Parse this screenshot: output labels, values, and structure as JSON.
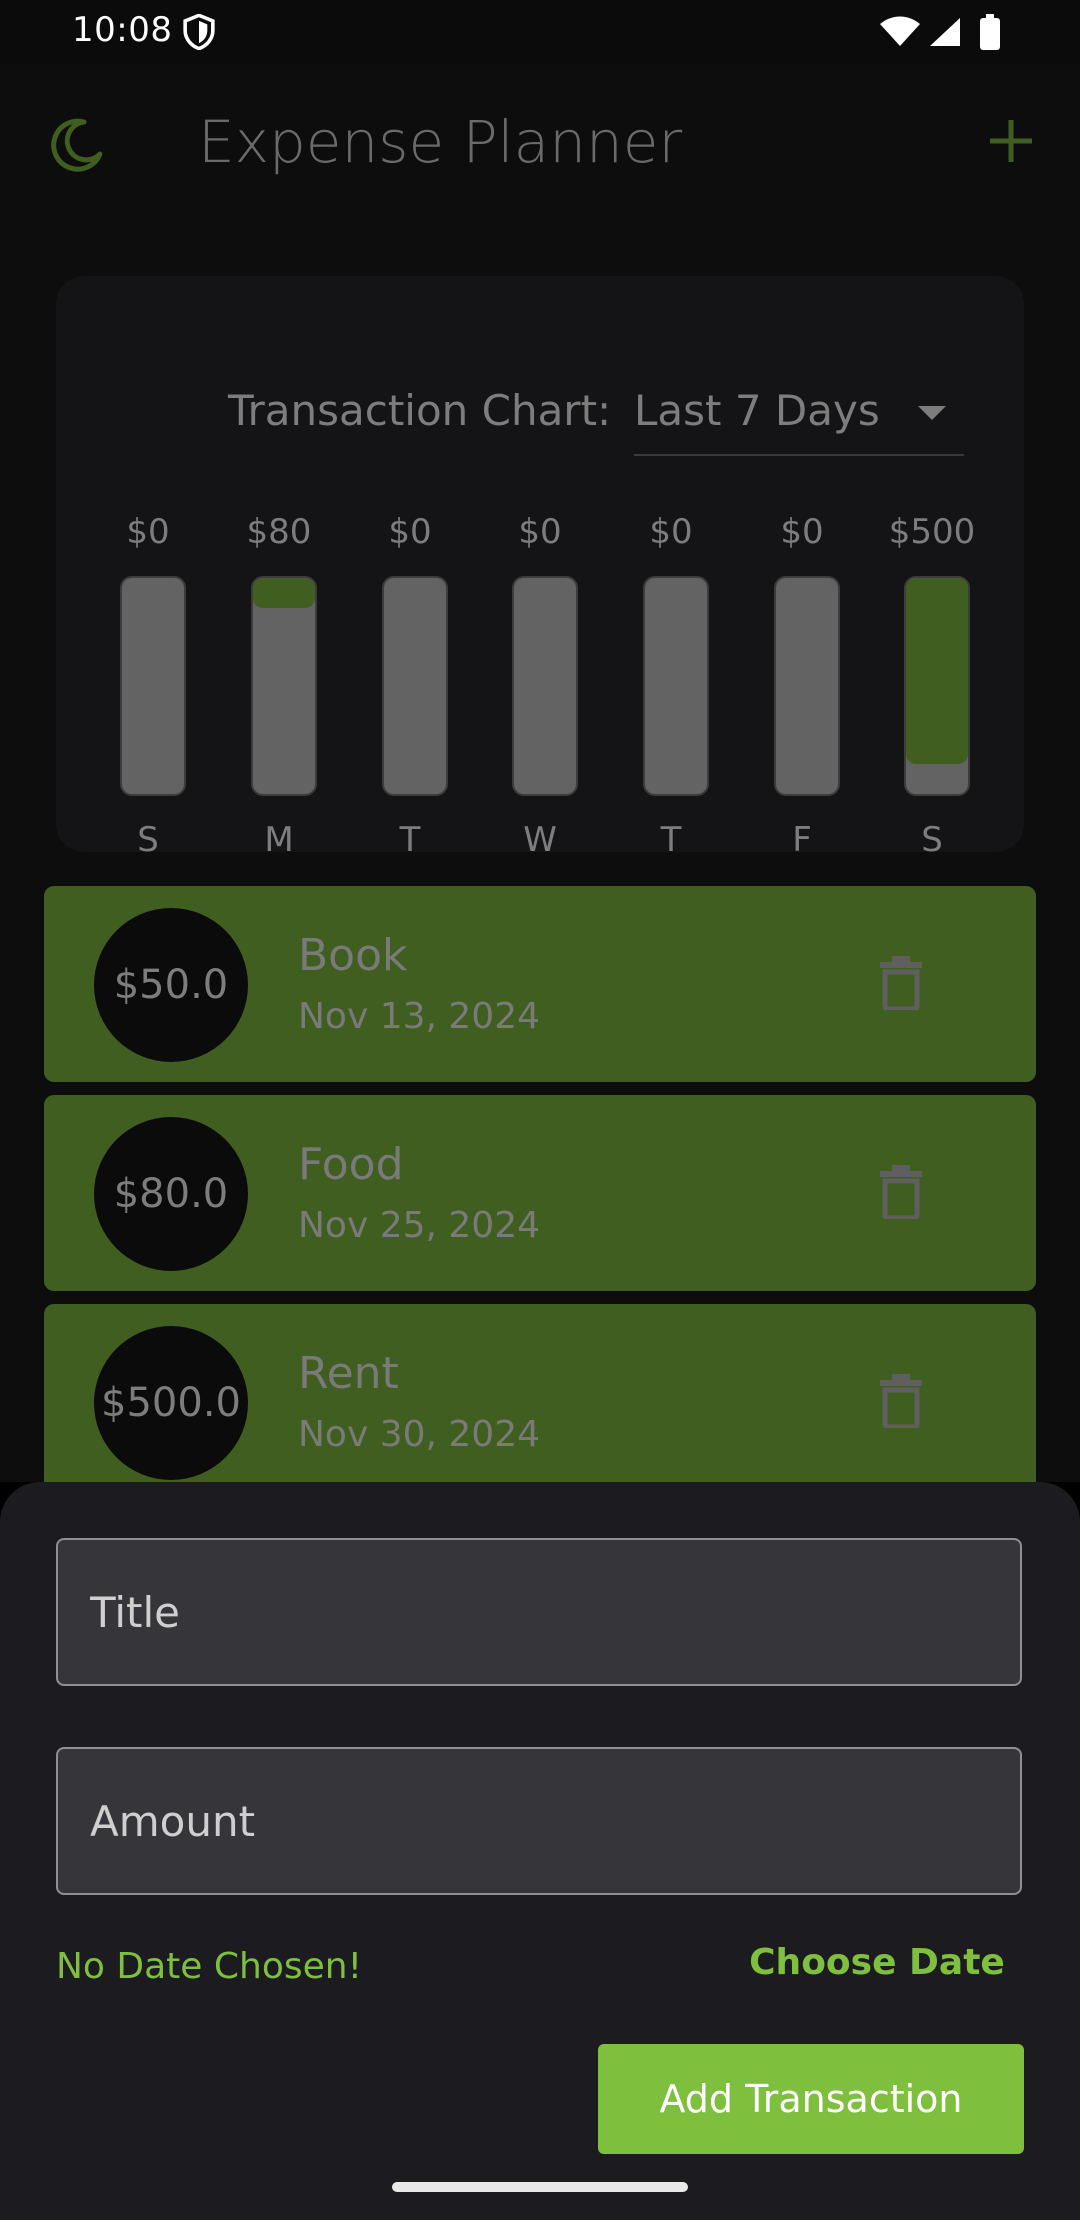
{
  "status_bar": {
    "time": "10:08"
  },
  "app_bar": {
    "title": "Expense Planner",
    "left_icon": "moon-icon",
    "right_icon": "plus-icon"
  },
  "chart": {
    "label": "Transaction Chart:",
    "period": "Last 7 Days",
    "bars": [
      {
        "day": "S",
        "amount": "$0",
        "fill": 0
      },
      {
        "day": "M",
        "amount": "$80",
        "fill": 0.14
      },
      {
        "day": "T",
        "amount": "$0",
        "fill": 0
      },
      {
        "day": "W",
        "amount": "$0",
        "fill": 0
      },
      {
        "day": "T",
        "amount": "$0",
        "fill": 0
      },
      {
        "day": "F",
        "amount": "$0",
        "fill": 0
      },
      {
        "day": "S",
        "amount": "$500",
        "fill": 0.86
      }
    ]
  },
  "chart_data": {
    "type": "bar",
    "categories": [
      "S",
      "M",
      "T",
      "W",
      "T",
      "F",
      "S"
    ],
    "values": [
      0,
      80,
      0,
      0,
      0,
      0,
      500
    ],
    "title": "Transaction Chart: Last 7 Days"
  },
  "transactions": [
    {
      "amount": "$50.0",
      "title": "Book",
      "date": "Nov 13, 2024"
    },
    {
      "amount": "$80.0",
      "title": "Food",
      "date": "Nov 25, 2024"
    },
    {
      "amount": "$500.0",
      "title": "Rent",
      "date": "Nov 30, 2024"
    }
  ],
  "sheet": {
    "title_placeholder": "Title",
    "amount_placeholder": "Amount",
    "no_date": "No Date Chosen!",
    "choose_date": "Choose Date",
    "add_button": "Add Transaction"
  },
  "colors": {
    "accent": "#7fbf3e",
    "card_green": "#3f5e1f",
    "sheet_bg": "#1c1b1f"
  }
}
